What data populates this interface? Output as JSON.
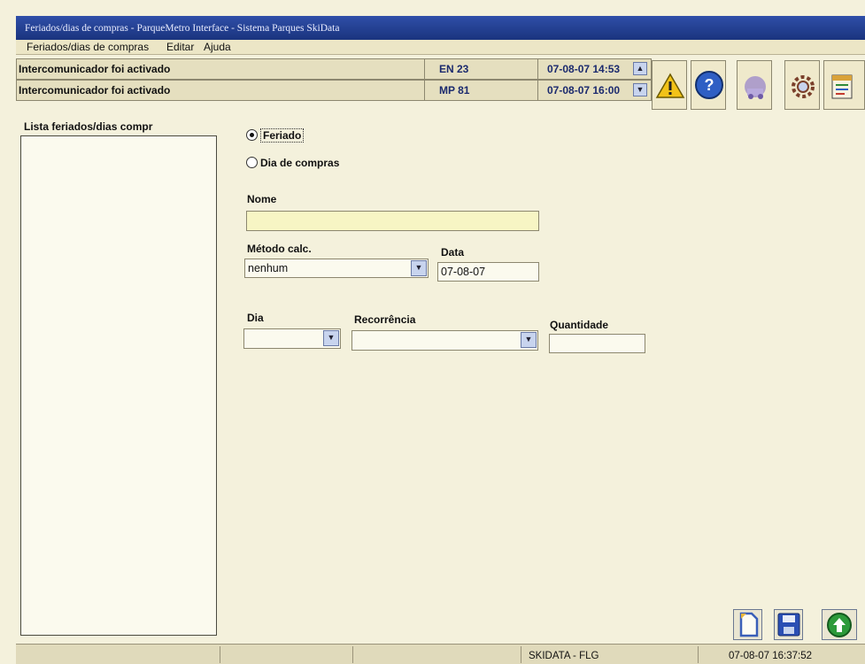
{
  "window": {
    "title": "Feriados/dias de compras - ParqueMetro Interface - Sistema Parques SkiData"
  },
  "menu": [
    "Feriados/dias de compras",
    "Editar",
    "Ajuda"
  ],
  "alarms": [
    {
      "message": "Intercomunicador foi activado",
      "code": "EN 23",
      "time": "07-08-07 14:53"
    },
    {
      "message": "Intercomunicador foi activado",
      "code": "MP 81",
      "time": "07-08-07 16:00"
    }
  ],
  "toolbar": {
    "icons": [
      "warning-icon",
      "help-icon",
      "parking-meter-icon",
      "settings-gear-icon",
      "calendar-report-icon"
    ]
  },
  "list": {
    "label": "Lista feriados/dias compr"
  },
  "form": {
    "type_options": [
      "Feriado",
      "Dia de compras"
    ],
    "selected_type": "Feriado",
    "name_label": "Nome",
    "name_value": "",
    "method_label": "Método calc.",
    "method_value": "nenhum",
    "date_label": "Data",
    "date_value": "07-08-07",
    "day_label": "Dia",
    "day_value": "",
    "recurrence_label": "Recorrência",
    "recurrence_value": "",
    "quantity_label": "Quantidade",
    "quantity_value": ""
  },
  "buttons": {
    "icons": [
      "new-document-icon",
      "save-icon",
      "upload-icon"
    ]
  },
  "status": {
    "system": "SKIDATA - FLG",
    "datetime": "07-08-07 16:37:52"
  },
  "colors": {
    "titlebar": "#1f3b8c",
    "background": "#f4f1dc",
    "name_field": "#f7f5c4",
    "accent_blue": "#2f4fa8",
    "warning_yellow": "#f2c318",
    "ok_green": "#2c9a3a"
  }
}
